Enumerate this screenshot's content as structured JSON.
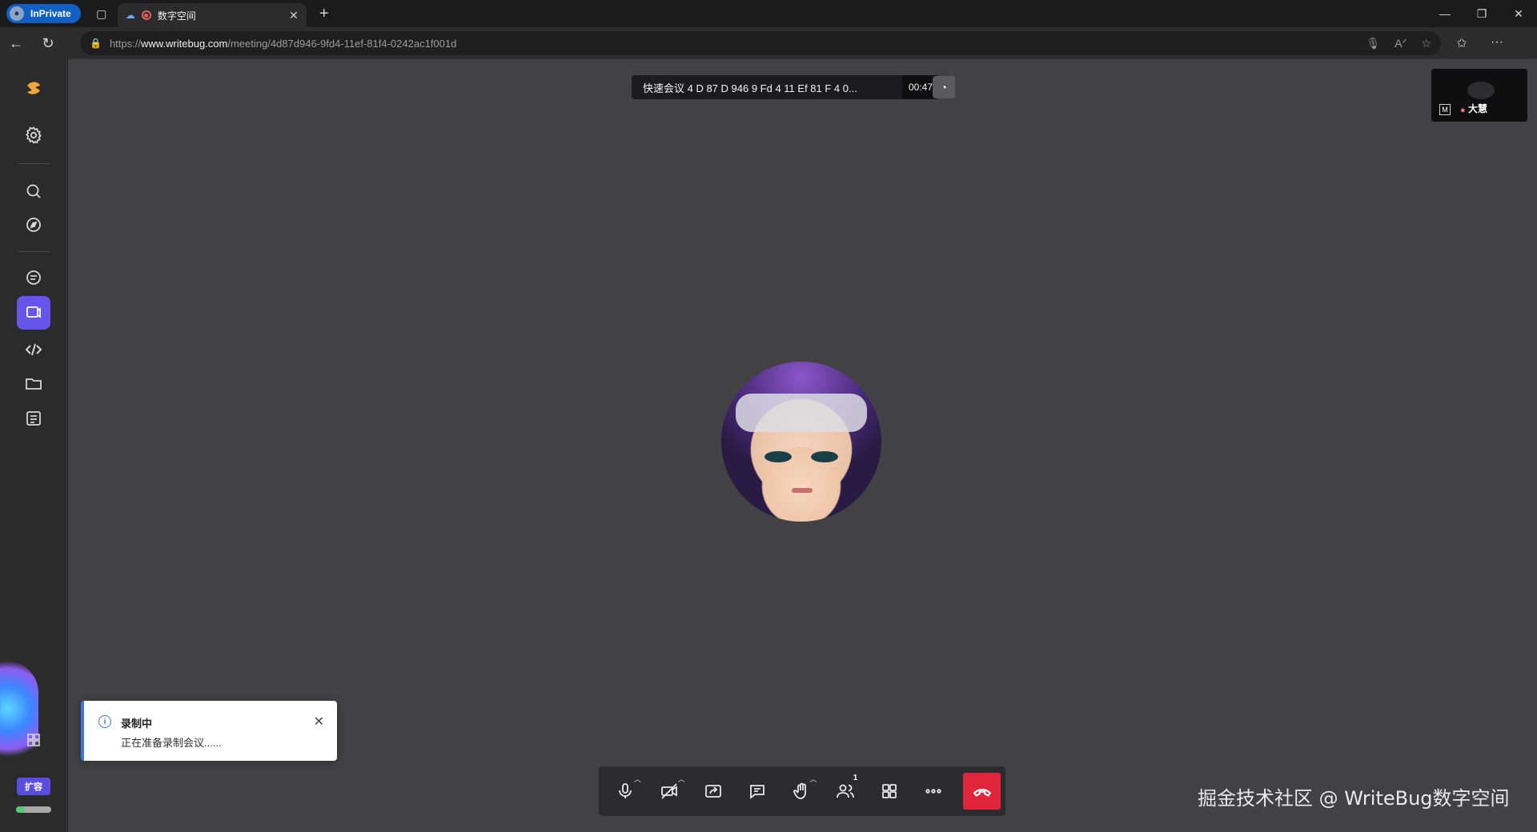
{
  "browser": {
    "inprivate_label": "InPrivate",
    "tab_title": "数字空间",
    "url_prefix": "https://",
    "url_domain": "www.writebug.com",
    "url_path": "/meeting/4d87d946-9fd4-11ef-81f4-0242ac1f001d"
  },
  "sidebar": {
    "items": [
      {
        "name": "logo"
      },
      {
        "name": "settings"
      },
      {
        "name": "search"
      },
      {
        "name": "explore"
      },
      {
        "name": "chat"
      },
      {
        "name": "meeting",
        "active": true
      },
      {
        "name": "code"
      },
      {
        "name": "folder"
      },
      {
        "name": "tasks"
      }
    ],
    "expand_label": "扩容",
    "storage_used_fraction": 0.22
  },
  "meeting": {
    "title": "快速会议 4 D 87 D 946 9 Fd 4 11 Ef 81 F 4 0...",
    "timer": "00:47",
    "self_view_badge": "M",
    "self_view_name": "大慧",
    "participants_count": "1"
  },
  "toast": {
    "title": "录制中",
    "message": "正在准备录制会议......"
  },
  "watermark": "掘金技术社区 @ WriteBug数字空间",
  "colors": {
    "accent": "#6655e8",
    "hangup": "#e0253a",
    "toast_accent": "#3c78e6"
  }
}
